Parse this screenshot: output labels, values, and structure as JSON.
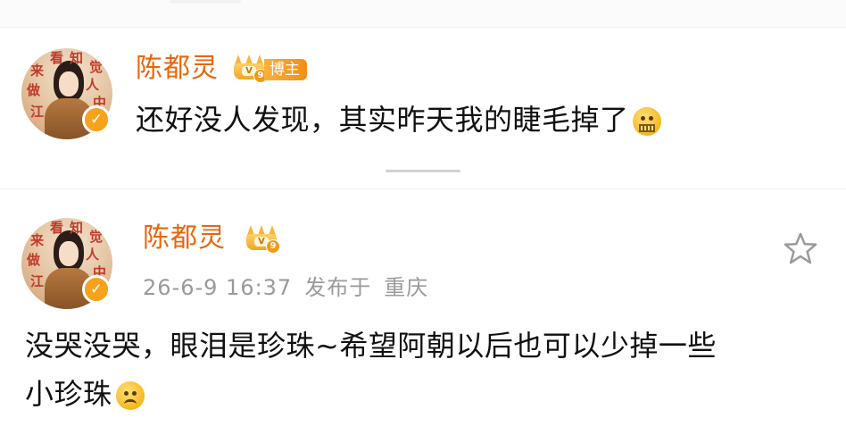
{
  "reply": {
    "author": "陈都灵",
    "author_badge": "博主",
    "level": "9",
    "content": "还好没人发现，其实昨天我的睫毛掉了",
    "emoji_icon": "zipper-mouth-face-emoji",
    "avatar_text": [
      "来",
      "看",
      "知",
      "觉",
      "人",
      "中",
      "做",
      "江"
    ]
  },
  "post": {
    "author": "陈都灵",
    "level": "9",
    "timestamp": "26-6-9 16:37",
    "location_prefix": "发布于",
    "location": "重庆",
    "content_line1": "没哭没哭，眼泪是珍珠~希望阿朝以后也可以少掉一些",
    "content_line2": "小珍珠",
    "emoji_icon": "frowning-face-emoji",
    "favorite_icon": "star-outline-icon",
    "avatar_text": [
      "来",
      "看",
      "知",
      "觉",
      "人",
      "中",
      "做",
      "江"
    ]
  },
  "colors": {
    "accent_name": "#e8660b",
    "badge": "#f3a51f",
    "meta_gray": "#9a9a9a"
  }
}
